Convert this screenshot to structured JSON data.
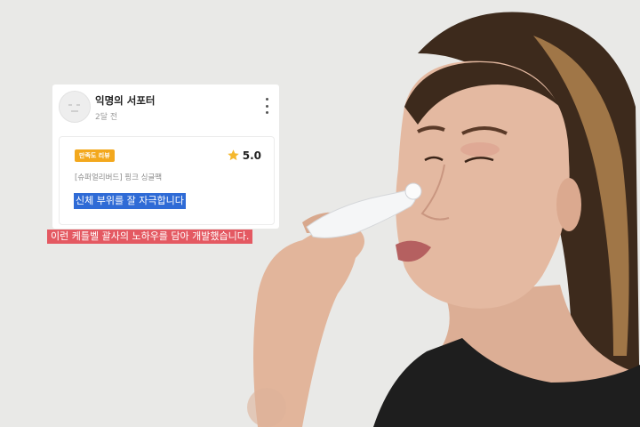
{
  "review": {
    "author": "익명의 서포터",
    "time": "2달 전",
    "badge": "만족도 리뷰",
    "rating": "5.0",
    "product": "[슈퍼얼리버드] 핑크 싱글팩",
    "text": "신체 부위를 잘 자극합니다"
  },
  "subtitle": "이런 케틀벨 괄사의 노하우를 담아 개발했습니다.",
  "icons": {
    "avatar": "avatar-face-icon",
    "more": "more-vertical-icon",
    "star": "star-icon"
  },
  "colors": {
    "badge": "#f3a81d",
    "star": "#f5b82e",
    "highlight": "#2f6bd6",
    "subtitle_bg": "#e45962",
    "background": "#e9e9e7"
  }
}
